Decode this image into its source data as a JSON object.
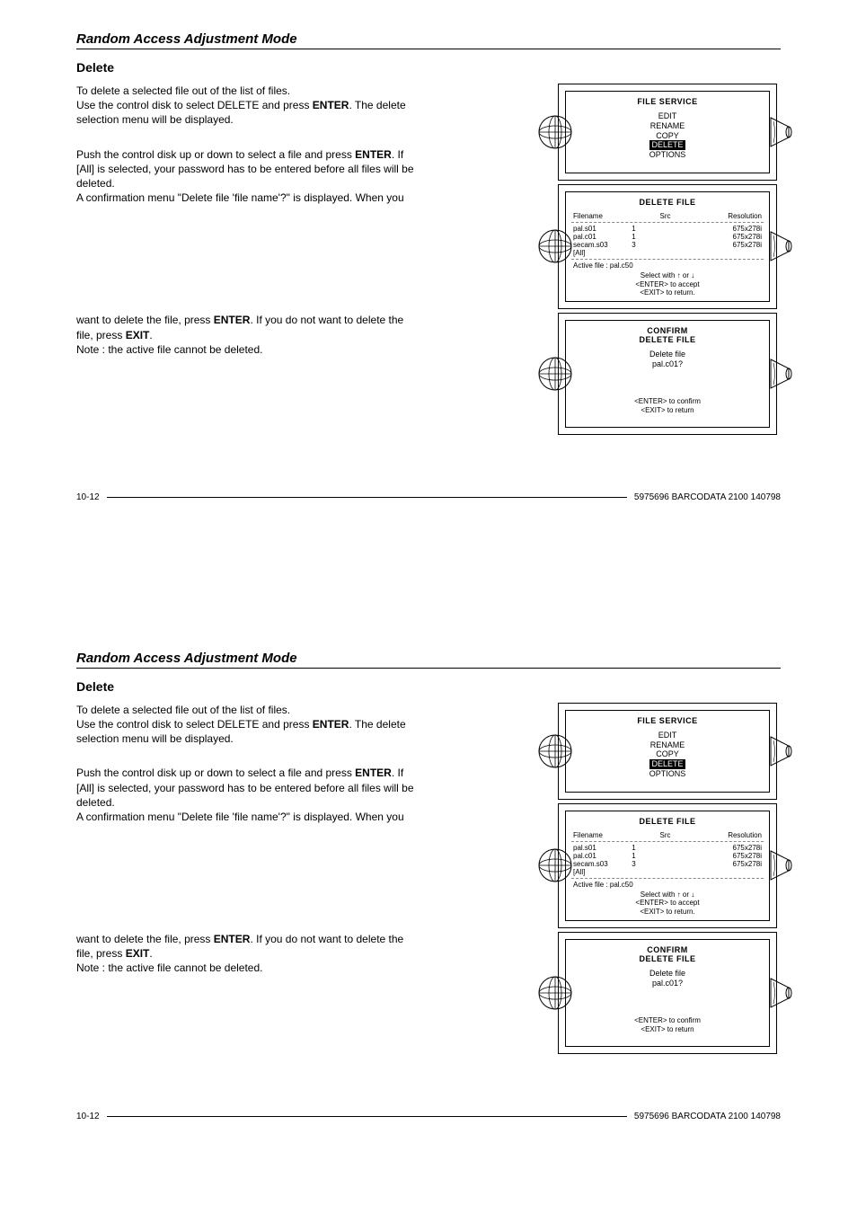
{
  "section_title": "Random Access Adjustment Mode",
  "sub_title": "Delete",
  "para1a": "To delete a selected file out of the list of files.",
  "para1b_pre": "Use the control disk to select DELETE and press ",
  "enter": "ENTER",
  "para1b_post": ".  The delete selection menu will be displayed.",
  "para2a_pre": "Push the control disk up or down to select a file and press ",
  "para2a_post": ". If [All] is selected, your password has to be entered before all files will be deleted.",
  "para2b": "A confirmation menu \"Delete file 'file name'?\" is displayed.  When you",
  "para3a_pre": "want to delete the file, press ",
  "para3a_mid": ".  If you do not want to delete the file, press ",
  "exit": "EXIT",
  "para3a_post": ".",
  "para3b": "Note : the active file cannot be deleted.",
  "menu1": {
    "title": "FILE  SERVICE",
    "items": [
      "EDIT",
      "RENAME",
      "COPY"
    ],
    "selected": "DELETE",
    "after": "OPTIONS"
  },
  "menu2": {
    "title": "DELETE  FILE",
    "h1": "Filename",
    "h2": "Src",
    "h3": "Resolution",
    "rows": [
      {
        "name": "pal.s01",
        "src": "1",
        "res": "675x278i"
      },
      {
        "name": "pal.c01",
        "src": "1",
        "res": "675x278i"
      },
      {
        "name": "secam.s03",
        "src": "3",
        "res": "675x278i"
      },
      {
        "name": "[All]",
        "src": "",
        "res": ""
      }
    ],
    "active": "Active file : pal.c50",
    "hint1": "Select with ↑ or ↓",
    "hint2": "<ENTER> to accept",
    "hint3": "<EXIT> to return."
  },
  "menu3": {
    "title1": "CONFIRM",
    "title2": "DELETE  FILE",
    "line1": "Delete file",
    "line2": "pal.c01?",
    "hint1": "<ENTER> to confirm",
    "hint2": "<EXIT> to return"
  },
  "footer_left": "10-12",
  "footer_right": "5975696 BARCODATA 2100 140798"
}
